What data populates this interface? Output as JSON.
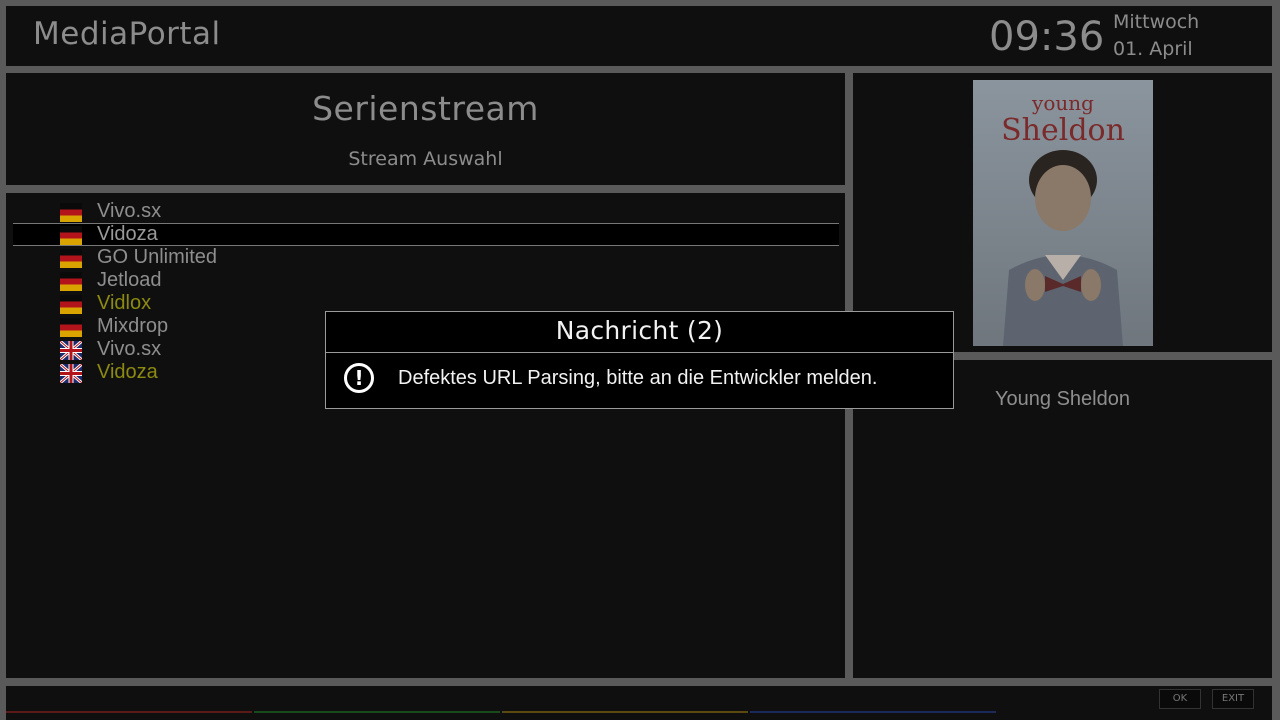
{
  "header": {
    "app_title": "MediaPortal",
    "clock": "09:36",
    "weekday": "Mittwoch",
    "date": "01. April"
  },
  "section": {
    "title": "Serienstream",
    "subtitle": "Stream Auswahl"
  },
  "streams": [
    {
      "label": "Vivo.sx",
      "flag": "de-flag-icon",
      "color": "#8e8e8e",
      "selected": false
    },
    {
      "label": "Vidoza",
      "flag": "de-flag-icon",
      "color": "#8e8e8e",
      "selected": true
    },
    {
      "label": "GO Unlimited",
      "flag": "de-flag-icon",
      "color": "#8e8e8e",
      "selected": false
    },
    {
      "label": "Jetload",
      "flag": "de-flag-icon",
      "color": "#8e8e8e",
      "selected": false
    },
    {
      "label": "Vidlox",
      "flag": "de-flag-icon",
      "color": "#8c8a10",
      "selected": false
    },
    {
      "label": "Mixdrop",
      "flag": "de-flag-icon",
      "color": "#8e8e8e",
      "selected": false
    },
    {
      "label": "Vivo.sx",
      "flag": "uk-flag-icon",
      "color": "#8e8e8e",
      "selected": false
    },
    {
      "label": "Vidoza",
      "flag": "uk-flag-icon",
      "color": "#8c8a10",
      "selected": false
    }
  ],
  "cover": {
    "logo_line1": "young",
    "logo_line2": "Sheldon"
  },
  "info": {
    "series_name": "Young Sheldon"
  },
  "footer": {
    "ok_label": "OK",
    "exit_label": "EXIT",
    "color_keys": [
      "#8a1a1a",
      "#1a6a1a",
      "#8a6a10",
      "#1a3a8a"
    ]
  },
  "dialog": {
    "title": "Nachricht (2)",
    "icon": "exclamation-icon",
    "message": "Defektes URL Parsing, bitte an die Entwickler melden."
  }
}
